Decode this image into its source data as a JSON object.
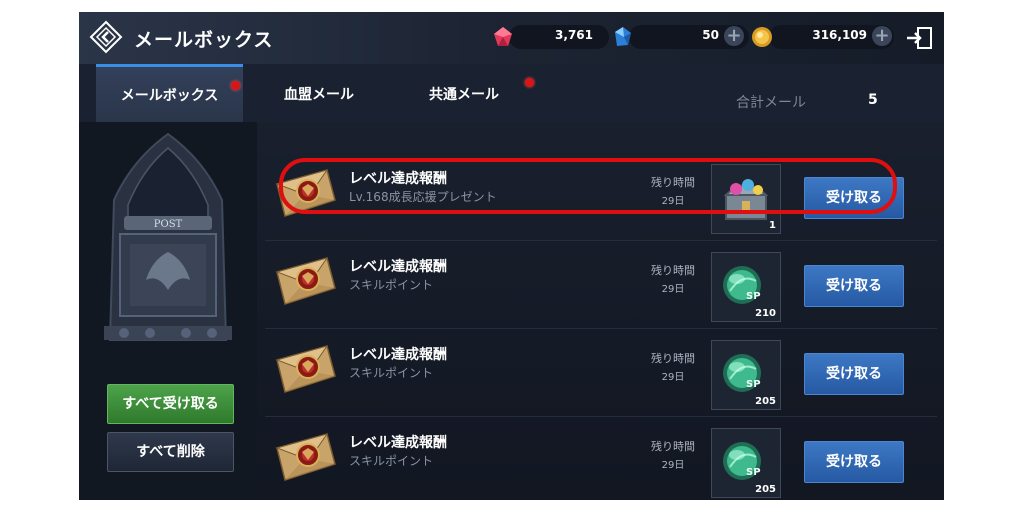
{
  "header": {
    "title": "メールボックス",
    "back_icon": "diamond-back-icon",
    "resources": [
      {
        "icon": "red-gem-icon",
        "value": "3,761",
        "color": "#e0395a"
      },
      {
        "icon": "blue-crystal-icon",
        "value": "50",
        "color": "#4aa3f0"
      },
      {
        "icon": "gold-coin-icon",
        "value": "316,109",
        "color": "#e8b23a"
      }
    ],
    "exit_icon": "exit-door-icon"
  },
  "tabs": [
    {
      "label": "メールボックス",
      "active": true,
      "notification": true
    },
    {
      "label": "血盟メール",
      "active": false,
      "notification": false
    },
    {
      "label": "共通メール",
      "active": false,
      "notification": true
    }
  ],
  "total": {
    "label": "合計メール",
    "value": "5"
  },
  "left_panel": {
    "mailbox_sign": "POST",
    "claim_all_label": "すべて受け取る",
    "delete_all_label": "すべて削除"
  },
  "mails": [
    {
      "title": "レベル達成報酬",
      "subtitle": "Lv.168成長応援プレゼント",
      "remain_label": "残り時間",
      "remain_value": "29日",
      "item_icon": "treasure-chest-icon",
      "item_count": "1",
      "button": "受け取る"
    },
    {
      "title": "レベル達成報酬",
      "subtitle": "スキルポイント",
      "remain_label": "残り時間",
      "remain_value": "29日",
      "item_icon": "skill-point-orb-icon",
      "item_count": "210",
      "button": "受け取る"
    },
    {
      "title": "レベル達成報酬",
      "subtitle": "スキルポイント",
      "remain_label": "残り時間",
      "remain_value": "29日",
      "item_icon": "skill-point-orb-icon",
      "item_count": "205",
      "button": "受け取る"
    },
    {
      "title": "レベル達成報酬",
      "subtitle": "スキルポイント",
      "remain_label": "残り時間",
      "remain_value": "29日",
      "item_icon": "skill-point-orb-icon",
      "item_count": "205",
      "button": "受け取る"
    }
  ],
  "colors": {
    "accent_blue": "#3b8ee5",
    "highlight_red": "#e00f0f",
    "claim_green": "#3f8f3c"
  }
}
